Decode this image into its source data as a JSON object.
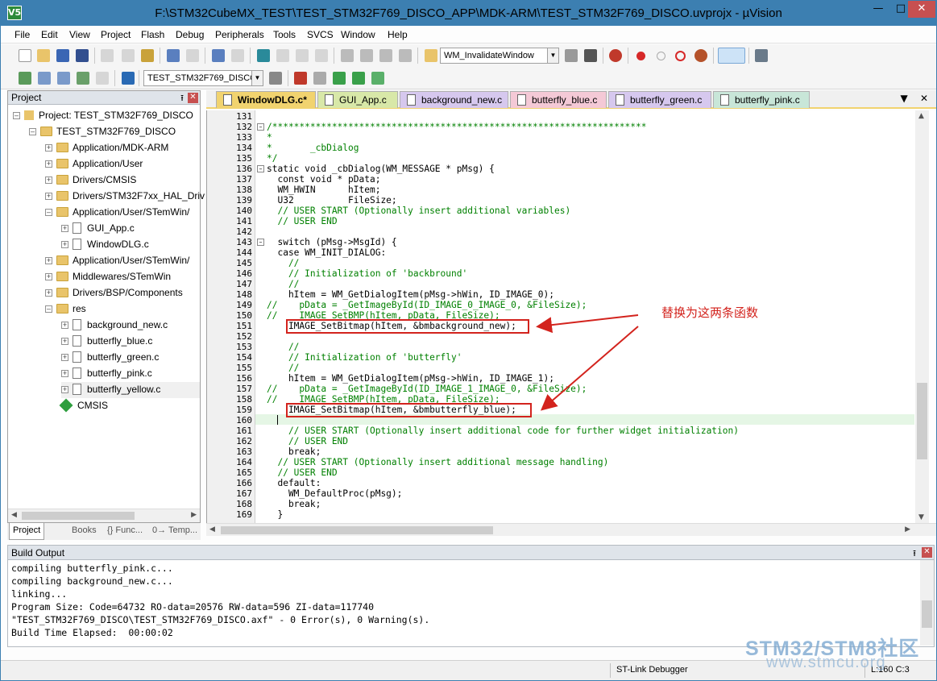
{
  "window": {
    "title": "F:\\STM32CubeMX_TEST\\TEST_STM32F769_DISCO_APP\\MDK-ARM\\TEST_STM32F769_DISCO.uvprojx - µVision",
    "app_icon": "V5"
  },
  "menu": [
    "File",
    "Edit",
    "View",
    "Project",
    "Flash",
    "Debug",
    "Peripherals",
    "Tools",
    "SVCS",
    "Window",
    "Help"
  ],
  "toolbar": {
    "function_combo": "WM_InvalidateWindow",
    "target_combo": "TEST_STM32F769_DISCO"
  },
  "project_panel": {
    "title": "Project",
    "tree": [
      {
        "label": "Project: TEST_STM32F769_DISCO",
        "icon": "project-icon"
      },
      {
        "label": "TEST_STM32F769_DISCO",
        "icon": "target-icon"
      },
      {
        "label": "Application/MDK-ARM",
        "icon": "folder-icon"
      },
      {
        "label": "Application/User",
        "icon": "folder-icon"
      },
      {
        "label": "Drivers/CMSIS",
        "icon": "folder-icon"
      },
      {
        "label": "Drivers/STM32F7xx_HAL_Driv",
        "icon": "folder-icon"
      },
      {
        "label": "Application/User/STemWin/",
        "icon": "folder-icon"
      },
      {
        "label": "GUI_App.c",
        "icon": "file-icon"
      },
      {
        "label": "WindowDLG.c",
        "icon": "file-icon"
      },
      {
        "label": "Application/User/STemWin/",
        "icon": "folder-icon"
      },
      {
        "label": "Middlewares/STemWin",
        "icon": "folder-icon"
      },
      {
        "label": "Drivers/BSP/Components",
        "icon": "folder-icon"
      },
      {
        "label": "res",
        "icon": "folder-icon"
      },
      {
        "label": "background_new.c",
        "icon": "file-icon"
      },
      {
        "label": "butterfly_blue.c",
        "icon": "file-icon"
      },
      {
        "label": "butterfly_green.c",
        "icon": "file-icon"
      },
      {
        "label": "butterfly_pink.c",
        "icon": "file-icon"
      },
      {
        "label": "butterfly_yellow.c",
        "icon": "file-icon"
      },
      {
        "label": "CMSIS",
        "icon": "cmsis-icon"
      }
    ],
    "tabs": [
      "Project",
      "Books",
      "{} Func...",
      "0→ Temp..."
    ]
  },
  "editor": {
    "tabs": [
      {
        "label": "WindowDLG.c*",
        "color": "#f1d36f"
      },
      {
        "label": "GUI_App.c",
        "color": "#d8e8a8"
      },
      {
        "label": "background_new.c",
        "color": "#d6c8ee"
      },
      {
        "label": "butterfly_blue.c",
        "color": "#f4c9d6"
      },
      {
        "label": "butterfly_green.c",
        "color": "#d6c8ee"
      },
      {
        "label": "butterfly_pink.c",
        "color": "#c8e6d8"
      }
    ],
    "lines": [
      {
        "n": "131",
        "t": ""
      },
      {
        "n": "132",
        "t": "/*********************************************************************",
        "c": "cm"
      },
      {
        "n": "133",
        "t": "*",
        "c": "cm"
      },
      {
        "n": "134",
        "t": "*       _cbDialog",
        "c": "cm"
      },
      {
        "n": "135",
        "t": "*/",
        "c": "cm"
      },
      {
        "n": "136",
        "t": "static void _cbDialog(WM_MESSAGE * pMsg) {"
      },
      {
        "n": "137",
        "t": "  const void * pData;"
      },
      {
        "n": "138",
        "t": "  WM_HWIN      hItem;"
      },
      {
        "n": "139",
        "t": "  U32          FileSize;"
      },
      {
        "n": "140",
        "t": "  // USER START (Optionally insert additional variables)",
        "c": "cm"
      },
      {
        "n": "141",
        "t": "  // USER END",
        "c": "cm"
      },
      {
        "n": "142",
        "t": ""
      },
      {
        "n": "143",
        "t": "  switch (pMsg->MsgId) {"
      },
      {
        "n": "144",
        "t": "  case WM_INIT_DIALOG:"
      },
      {
        "n": "145",
        "t": "    //",
        "c": "cm"
      },
      {
        "n": "146",
        "t": "    // Initialization of 'backbround'",
        "c": "cm"
      },
      {
        "n": "147",
        "t": "    //",
        "c": "cm"
      },
      {
        "n": "148",
        "t": "    hItem = WM_GetDialogItem(pMsg->hWin, ID_IMAGE_0);"
      },
      {
        "n": "149",
        "t": "//    pData = _GetImageById(ID_IMAGE_0_IMAGE_0, &FileSize);",
        "c": "cm"
      },
      {
        "n": "150",
        "t": "//    IMAGE_SetBMP(hItem, pData, FileSize);",
        "c": "cm"
      },
      {
        "n": "151",
        "t": "    IMAGE_SetBitmap(hItem, &bmbackground_new);"
      },
      {
        "n": "152",
        "t": ""
      },
      {
        "n": "153",
        "t": "    //",
        "c": "cm"
      },
      {
        "n": "154",
        "t": "    // Initialization of 'butterfly'",
        "c": "cm"
      },
      {
        "n": "155",
        "t": "    //",
        "c": "cm"
      },
      {
        "n": "156",
        "t": "    hItem = WM_GetDialogItem(pMsg->hWin, ID_IMAGE_1);"
      },
      {
        "n": "157",
        "t": "//    pData = _GetImageById(ID_IMAGE_1_IMAGE_0, &FileSize);",
        "c": "cm"
      },
      {
        "n": "158",
        "t": "//    IMAGE_SetBMP(hItem, pData, FileSize);",
        "c": "cm"
      },
      {
        "n": "159",
        "t": "    IMAGE_SetBitmap(hItem, &bmbutterfly_blue);"
      },
      {
        "n": "160",
        "t": ""
      },
      {
        "n": "161",
        "t": "    // USER START (Optionally insert additional code for further widget initialization)",
        "c": "cm"
      },
      {
        "n": "162",
        "t": "    // USER END",
        "c": "cm"
      },
      {
        "n": "163",
        "t": "    break;"
      },
      {
        "n": "164",
        "t": "  // USER START (Optionally insert additional message handling)",
        "c": "cm"
      },
      {
        "n": "165",
        "t": "  // USER END",
        "c": "cm"
      },
      {
        "n": "166",
        "t": "  default:"
      },
      {
        "n": "167",
        "t": "    WM_DefaultProc(pMsg);"
      },
      {
        "n": "168",
        "t": "    break;"
      },
      {
        "n": "169",
        "t": "  }"
      }
    ],
    "annotation": "替换为这两条函数",
    "accent": "#d3231d"
  },
  "build_output": {
    "title": "Build Output",
    "lines": [
      "compiling butterfly_pink.c...",
      "compiling background_new.c...",
      "linking...",
      "Program Size: Code=64732 RO-data=20576 RW-data=596 ZI-data=117740",
      "\"TEST_STM32F769_DISCO\\TEST_STM32F769_DISCO.axf\" - 0 Error(s), 0 Warning(s).",
      "Build Time Elapsed:  00:00:02"
    ]
  },
  "status": {
    "debugger": "ST-Link Debugger",
    "position": "L:160 C:3"
  },
  "watermark": {
    "brand": "STM32/STM8社区",
    "url": "www.stmcu.org"
  }
}
